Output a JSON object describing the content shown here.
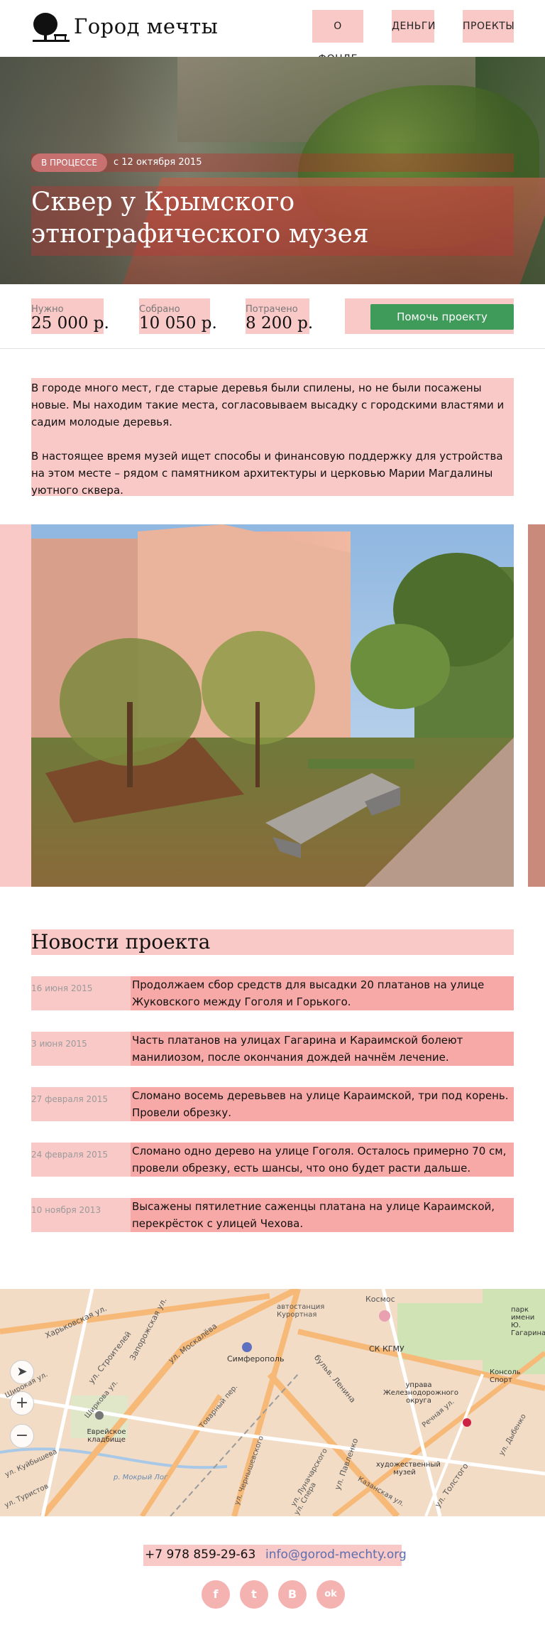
{
  "header": {
    "logo_text": "Город мечты",
    "nav": [
      {
        "label": "О ФОНДЕ"
      },
      {
        "label": "ДЕНЬГИ"
      },
      {
        "label": "ПРОЕКТЫ"
      }
    ]
  },
  "hero": {
    "badge": "В ПРОЦЕССЕ",
    "date": "с 12 октября 2015",
    "title_line1": "Сквер у Крымского",
    "title_line2": "этнографического музея"
  },
  "stats": {
    "needed_label": "Нужно",
    "needed_value": "25 000 р.",
    "collected_label": "Собрано",
    "collected_value": "10 050 р.",
    "spent_label": "Потрачено",
    "spent_value": "8 200 р.",
    "help_button": "Помочь проекту"
  },
  "description": {
    "p1": "В городе много мест, где старые деревья были спилены, но не были посажены новые. Мы находим такие места, согласовываем высадку с городскими властями и садим молодые деревья.",
    "p2": "В настоящее время музей ищет способы и финансовую поддержку для устройства на этом месте – рядом с памятником архитектуры и церковью Марии Магдалины уютного сквера."
  },
  "news": {
    "heading": "Новости проекта",
    "items": [
      {
        "date": "16 июня 2015",
        "text": "Продолжаем сбор средств для высадки 20 платанов на улице Жуковского между Гоголя и Горького."
      },
      {
        "date": "3 июня 2015",
        "text": "Часть платанов на улицах Гагарина и Караимской болеют манилиозом, после окончания дождей начнём лечение."
      },
      {
        "date": "27 февраля 2015",
        "text": "Сломано восемь деревьвев на улице Караимской, три под корень. Провели обрезку."
      },
      {
        "date": "24 февраля 2015",
        "text": "Сломано одно дерево на улице Гоголя. Осталось примерно 70 см, провели обрезку, есть шансы, что оно будет расти дальше."
      },
      {
        "date": "10 ноября 2013",
        "text": "Высажены пятилетние саженцы платана на улице Караимской, перекрёсток с улицей Чехова."
      }
    ]
  },
  "map": {
    "labels": [
      "Харьковская ул.",
      "ул. Строителей",
      "Запорожская ул.",
      "ул. Москалёва",
      "Симферополь",
      "автостанция Курортная",
      "Космос",
      "СК КГМУ",
      "Еврейское кладбище",
      "Товарный пер.",
      "бульв. Ленина",
      "управа Железнодорожного округа",
      "Речная ул.",
      "художественный музей",
      "ул. Толстого",
      "ул. Дыбенко",
      "Консоль Спорт",
      "парк имени Ю. Гагарина",
      "р. Мокрый Лог",
      "ул. Павленко",
      "Казанская ул.",
      "ул. Чернышевского",
      "ул. Луначарского",
      "ул. Спера",
      "Ширкова ул.",
      "ул. Туристов",
      "ул. Куйбышева",
      "Широкая ул."
    ],
    "zoom_in": "+",
    "zoom_out": "−"
  },
  "footer": {
    "phone": "+7 978 859-29-63",
    "email": "info@gorod-mechty.org",
    "social": [
      "f",
      "t",
      "B",
      "ok"
    ]
  },
  "colors": {
    "accent_green": "#3f9b5a",
    "overlay_pink": "#f9c9c8",
    "overlay_mint": "#cff5ea",
    "link_blue": "#5a6fb0"
  }
}
